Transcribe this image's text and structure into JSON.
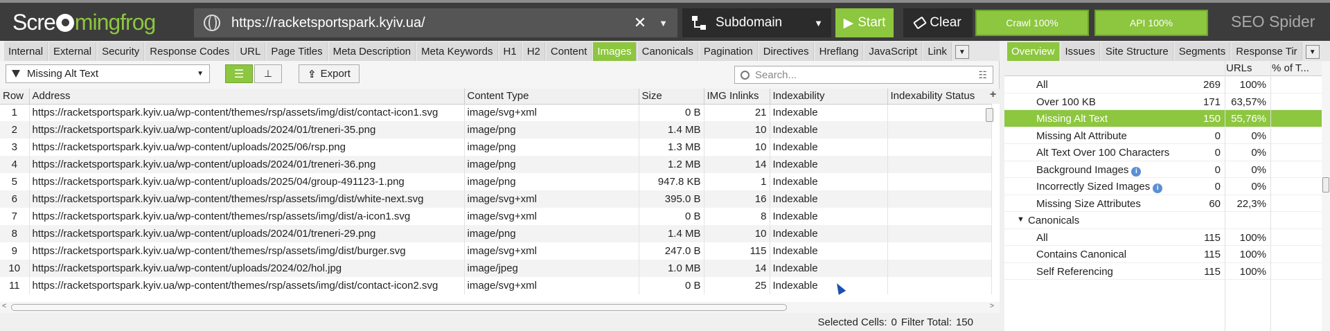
{
  "app": {
    "logo_prefix": "Scre",
    "logo_suffix": "mingfrog",
    "brand": "SEO Spider",
    "url": "https://racketsportspark.kyiv.ua/",
    "mode": "Subdomain",
    "start_label": "Start",
    "clear_label": "Clear",
    "crawl_progress": "Crawl 100%",
    "api_progress": "API 100%",
    "accent_color": "#8dc63f"
  },
  "main_tabs": [
    "Internal",
    "External",
    "Security",
    "Response Codes",
    "URL",
    "Page Titles",
    "Meta Description",
    "Meta Keywords",
    "H1",
    "H2",
    "Content",
    "Images",
    "Canonicals",
    "Pagination",
    "Directives",
    "Hreflang",
    "JavaScript",
    "Link"
  ],
  "main_tabs_active": "Images",
  "right_tabs": [
    "Overview",
    "Issues",
    "Site Structure",
    "Segments",
    "Response Tir"
  ],
  "right_tabs_active": "Overview",
  "toolbar": {
    "filter_value": "Missing Alt Text",
    "export_label": "Export",
    "search_placeholder": "Search..."
  },
  "grid": {
    "columns": [
      "Row",
      "Address",
      "Content Type",
      "Size",
      "IMG Inlinks",
      "Indexability",
      "Indexability Status"
    ],
    "rows": [
      [
        "1",
        "https://racketsportspark.kyiv.ua/wp-content/themes/rsp/assets/img/dist/contact-icon1.svg",
        "image/svg+xml",
        "0 B",
        "21",
        "Indexable",
        ""
      ],
      [
        "2",
        "https://racketsportspark.kyiv.ua/wp-content/uploads/2024/01/treneri-35.png",
        "image/png",
        "1.4 MB",
        "10",
        "Indexable",
        ""
      ],
      [
        "3",
        "https://racketsportspark.kyiv.ua/wp-content/uploads/2025/06/rsp.png",
        "image/png",
        "1.3 MB",
        "10",
        "Indexable",
        ""
      ],
      [
        "4",
        "https://racketsportspark.kyiv.ua/wp-content/uploads/2024/01/treneri-36.png",
        "image/png",
        "1.2 MB",
        "14",
        "Indexable",
        ""
      ],
      [
        "5",
        "https://racketsportspark.kyiv.ua/wp-content/uploads/2025/04/group-491123-1.png",
        "image/png",
        "947.8 KB",
        "1",
        "Indexable",
        ""
      ],
      [
        "6",
        "https://racketsportspark.kyiv.ua/wp-content/themes/rsp/assets/img/dist/white-next.svg",
        "image/svg+xml",
        "395.0 B",
        "16",
        "Indexable",
        ""
      ],
      [
        "7",
        "https://racketsportspark.kyiv.ua/wp-content/themes/rsp/assets/img/dist/a-icon1.svg",
        "image/svg+xml",
        "0 B",
        "8",
        "Indexable",
        ""
      ],
      [
        "8",
        "https://racketsportspark.kyiv.ua/wp-content/uploads/2024/01/treneri-29.png",
        "image/png",
        "1.4 MB",
        "10",
        "Indexable",
        ""
      ],
      [
        "9",
        "https://racketsportspark.kyiv.ua/wp-content/themes/rsp/assets/img/dist/burger.svg",
        "image/svg+xml",
        "247.0 B",
        "115",
        "Indexable",
        ""
      ],
      [
        "10",
        "https://racketsportspark.kyiv.ua/wp-content/uploads/2024/02/hol.jpg",
        "image/jpeg",
        "1.0 MB",
        "14",
        "Indexable",
        ""
      ],
      [
        "11",
        "https://racketsportspark.kyiv.ua/wp-content/themes/rsp/assets/img/dist/contact-icon2.svg",
        "image/svg+xml",
        "0 B",
        "25",
        "Indexable",
        ""
      ]
    ]
  },
  "status": {
    "selected_cells_label": "Selected Cells:",
    "selected_cells_value": "0",
    "filter_total_label": "Filter Total:",
    "filter_total_value": "150"
  },
  "overview": {
    "col_urls": "URLs",
    "col_pct": "% of T...",
    "rows": [
      {
        "label": "All",
        "urls": "269",
        "pct": "100%",
        "info": false,
        "selected": false,
        "section": false
      },
      {
        "label": "Over 100 KB",
        "urls": "171",
        "pct": "63,57%",
        "info": false,
        "selected": false,
        "section": false
      },
      {
        "label": "Missing Alt Text",
        "urls": "150",
        "pct": "55,76%",
        "info": false,
        "selected": true,
        "section": false
      },
      {
        "label": "Missing Alt Attribute",
        "urls": "0",
        "pct": "0%",
        "info": false,
        "selected": false,
        "section": false
      },
      {
        "label": "Alt Text Over 100 Characters",
        "urls": "0",
        "pct": "0%",
        "info": false,
        "selected": false,
        "section": false
      },
      {
        "label": "Background Images",
        "urls": "0",
        "pct": "0%",
        "info": true,
        "selected": false,
        "section": false
      },
      {
        "label": "Incorrectly Sized Images",
        "urls": "0",
        "pct": "0%",
        "info": true,
        "selected": false,
        "section": false
      },
      {
        "label": "Missing Size Attributes",
        "urls": "60",
        "pct": "22,3%",
        "info": false,
        "selected": false,
        "section": false
      },
      {
        "label": "Canonicals",
        "urls": "",
        "pct": "",
        "info": false,
        "selected": false,
        "section": true
      },
      {
        "label": "All",
        "urls": "115",
        "pct": "100%",
        "info": false,
        "selected": false,
        "section": false
      },
      {
        "label": "Contains Canonical",
        "urls": "115",
        "pct": "100%",
        "info": false,
        "selected": false,
        "section": false
      },
      {
        "label": "Self Referencing",
        "urls": "115",
        "pct": "100%",
        "info": false,
        "selected": false,
        "section": false
      }
    ]
  }
}
